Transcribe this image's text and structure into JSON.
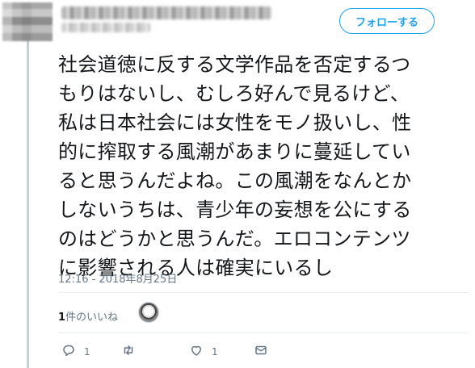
{
  "header": {
    "follow_label": "フォローする"
  },
  "tweet": {
    "lines": [
      "社会道徳に反する文学作品を否定するつ",
      "もりはないし、むしろ好んで見るけど、",
      "私は日本社会には女性をモノ扱いし、性",
      "的に搾取する風潮があまりに蔓延してい",
      "ると思うんだよね。この風潮をなんとか",
      "しないうちは、青少年の妄想を公にする",
      "のはどうかと思うんだ。エロコンテンツ",
      "に影響される人は確実にいるし"
    ],
    "timestamp": "12:16 - 2018年8月25日"
  },
  "likes": {
    "count": "1",
    "suffix": "件のいいね"
  },
  "actions": {
    "reply_count": "1",
    "like_count": "1"
  },
  "colors": {
    "accent": "#1da1f2",
    "muted": "#657786",
    "thread_line": "#c4cfd6"
  }
}
